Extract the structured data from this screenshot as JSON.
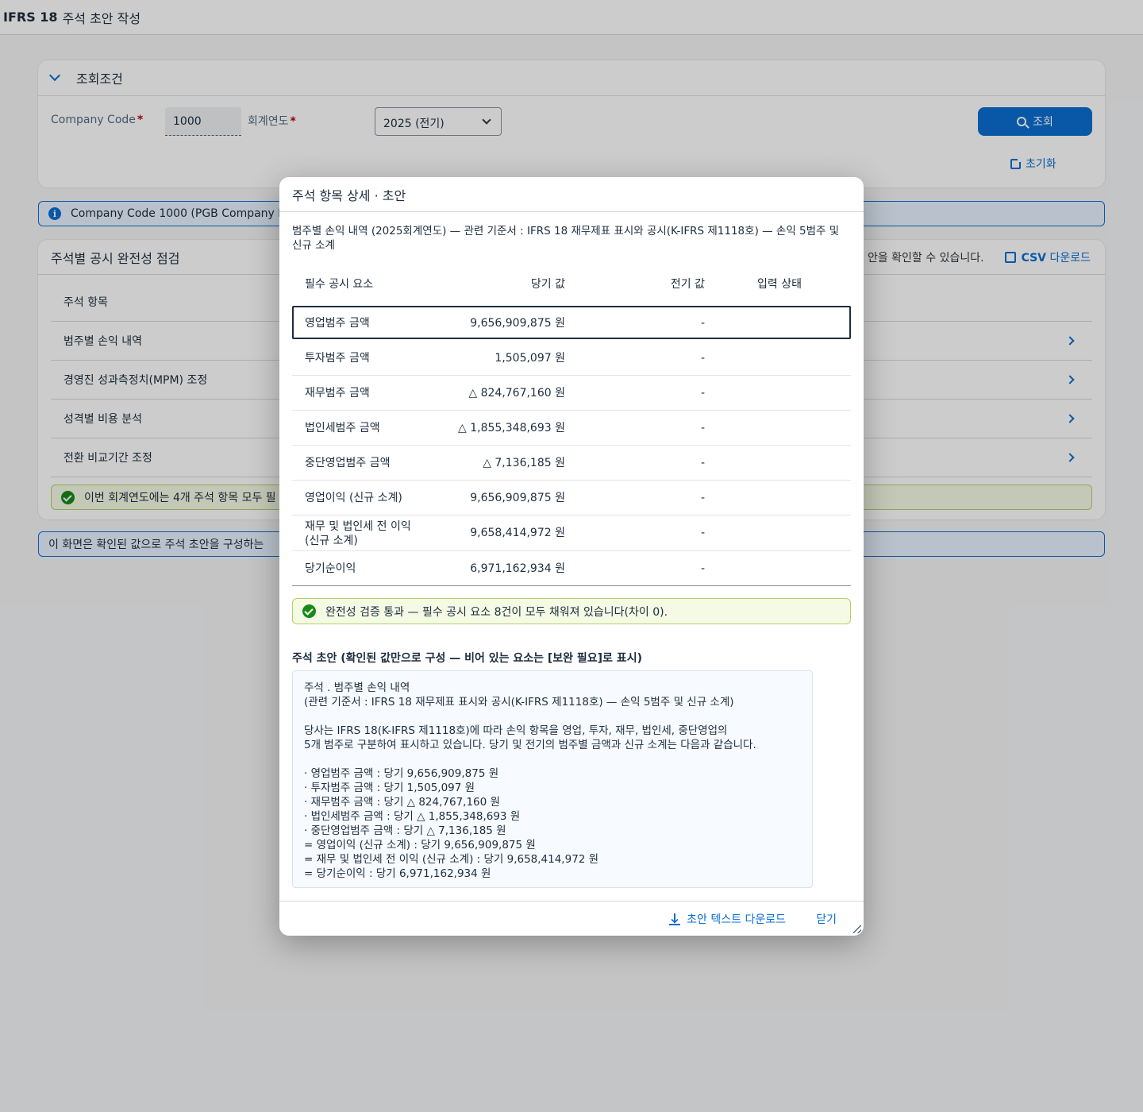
{
  "app": {
    "title_bold": "IFRS 18",
    "title_rest": "주석 초안 작성"
  },
  "filter": {
    "header": "조회조건",
    "company_code_label": "Company Code",
    "company_code_value": "1000",
    "fiscal_year_label": "회계연도",
    "required_mark": "*",
    "fiscal_year_value": "2025 (전기)",
    "search_label": "조회",
    "reset_label": "초기화"
  },
  "info_strip_1": "Company Code 1000 (PGB Company Limit",
  "check_panel": {
    "title": "주석별 공시 완전성 점검",
    "hint_text": "안을 확인할 수 있습니다.",
    "csv_bold": "CSV",
    "csv_rest": " 다운로드",
    "column_header": "주석 항목",
    "rows": [
      "범주별 손익 내역",
      "경영진 성과측정치(MPM) 조정",
      "성격별 비용 분석",
      "전환 비교기간 조정"
    ],
    "success_text": "이번 회계연도에는 4개 주석 항목 모두 필"
  },
  "info_strip_2": "이 화면은 확인된 값으로 주석 초안을 구성하는",
  "dialog": {
    "title": "주석 항목 상세 · 초안",
    "description": "범주별 손익 내역 (2025회계연도) — 관련 기준서 : IFRS 18 재무제표 표시와 공시(K-IFRS 제1118호) — 손익 5범주 및 신규 소계",
    "table": {
      "headers": [
        "필수 공시 요소",
        "당기 값",
        "전기 값",
        "입력 상태"
      ],
      "rows": [
        {
          "element": "영업범주 금액",
          "current": "9,656,909,875 원",
          "prior": "-"
        },
        {
          "element": "투자범주 금액",
          "current": "1,505,097 원",
          "prior": "-"
        },
        {
          "element": "재무범주 금액",
          "current": "△ 824,767,160 원",
          "prior": "-"
        },
        {
          "element": "법인세범주 금액",
          "current": "△ 1,855,348,693 원",
          "prior": "-"
        },
        {
          "element": "중단영업범주 금액",
          "current": "△ 7,136,185 원",
          "prior": "-"
        },
        {
          "element": "영업이익 (신규 소계)",
          "current": "9,656,909,875 원",
          "prior": "-"
        },
        {
          "element": "재무 및 법인세 전 이익\n(신규 소계)",
          "current": "9,658,414,972 원",
          "prior": "-"
        },
        {
          "element": "당기순이익",
          "current": "6,971,162,934 원",
          "prior": "-"
        }
      ]
    },
    "success_text": "완전성 검증 통과 — 필수 공시 요소 8건이 모두 채워져 있습니다(차이 0).",
    "draft_title": "주석 초안 (확인된 값만으로 구성 — 비어 있는 요소는 [보완 필요]로 표시)",
    "draft_text": "주석 . 범주별 손익 내역\n(관련 기준서 : IFRS 18 재무제표 표시와 공시(K-IFRS 제1118호) — 손익 5범주 및 신규 소계)\n\n당사는 IFRS 18(K-IFRS 제1118호)에 따라 손익 항목을 영업, 투자, 재무, 법인세, 중단영업의\n5개 범주로 구분하여 표시하고 있습니다. 당기 및 전기의 범주별 금액과 신규 소계는 다음과 같습니다.\n\n· 영업범주 금액 : 당기 9,656,909,875 원\n· 투자범주 금액 : 당기 1,505,097 원\n· 재무범주 금액 : 당기 △ 824,767,160 원\n· 법인세범주 금액 : 당기 △ 1,855,348,693 원\n· 중단영업범주 금액 : 당기 △ 7,136,185 원\n= 영업이익 (신규 소계) : 당기 9,656,909,875 원\n= 재무 및 법인세 전 이익 (신규 소계) : 당기 9,658,414,972 원\n= 당기순이익 : 당기 6,971,162,934 원",
    "download_label": "초안 텍스트 다운로드",
    "close_label": "닫기"
  }
}
